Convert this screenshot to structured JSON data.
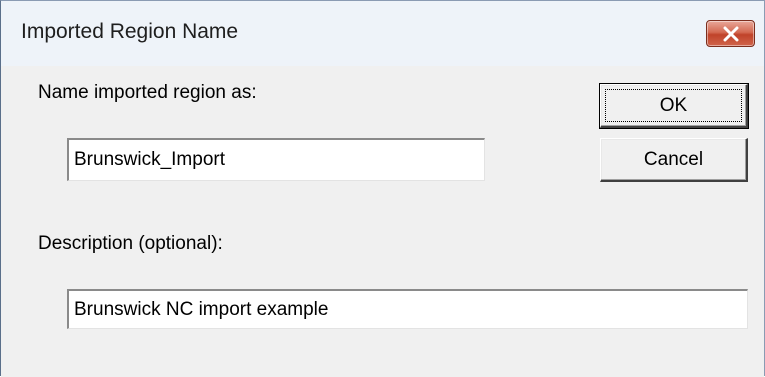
{
  "window": {
    "title": "Imported Region Name",
    "close_icon": "close-icon",
    "colors": {
      "close_button": "#c8533a",
      "dialog_bg": "#f0f0f0",
      "titlebar_bg": "#eef3f9"
    }
  },
  "form": {
    "name_label": "Name imported region as:",
    "name_value": "Brunswick_Import",
    "description_label": "Description (optional):",
    "description_value": "Brunswick NC import example"
  },
  "buttons": {
    "ok_label": "OK",
    "cancel_label": "Cancel"
  }
}
